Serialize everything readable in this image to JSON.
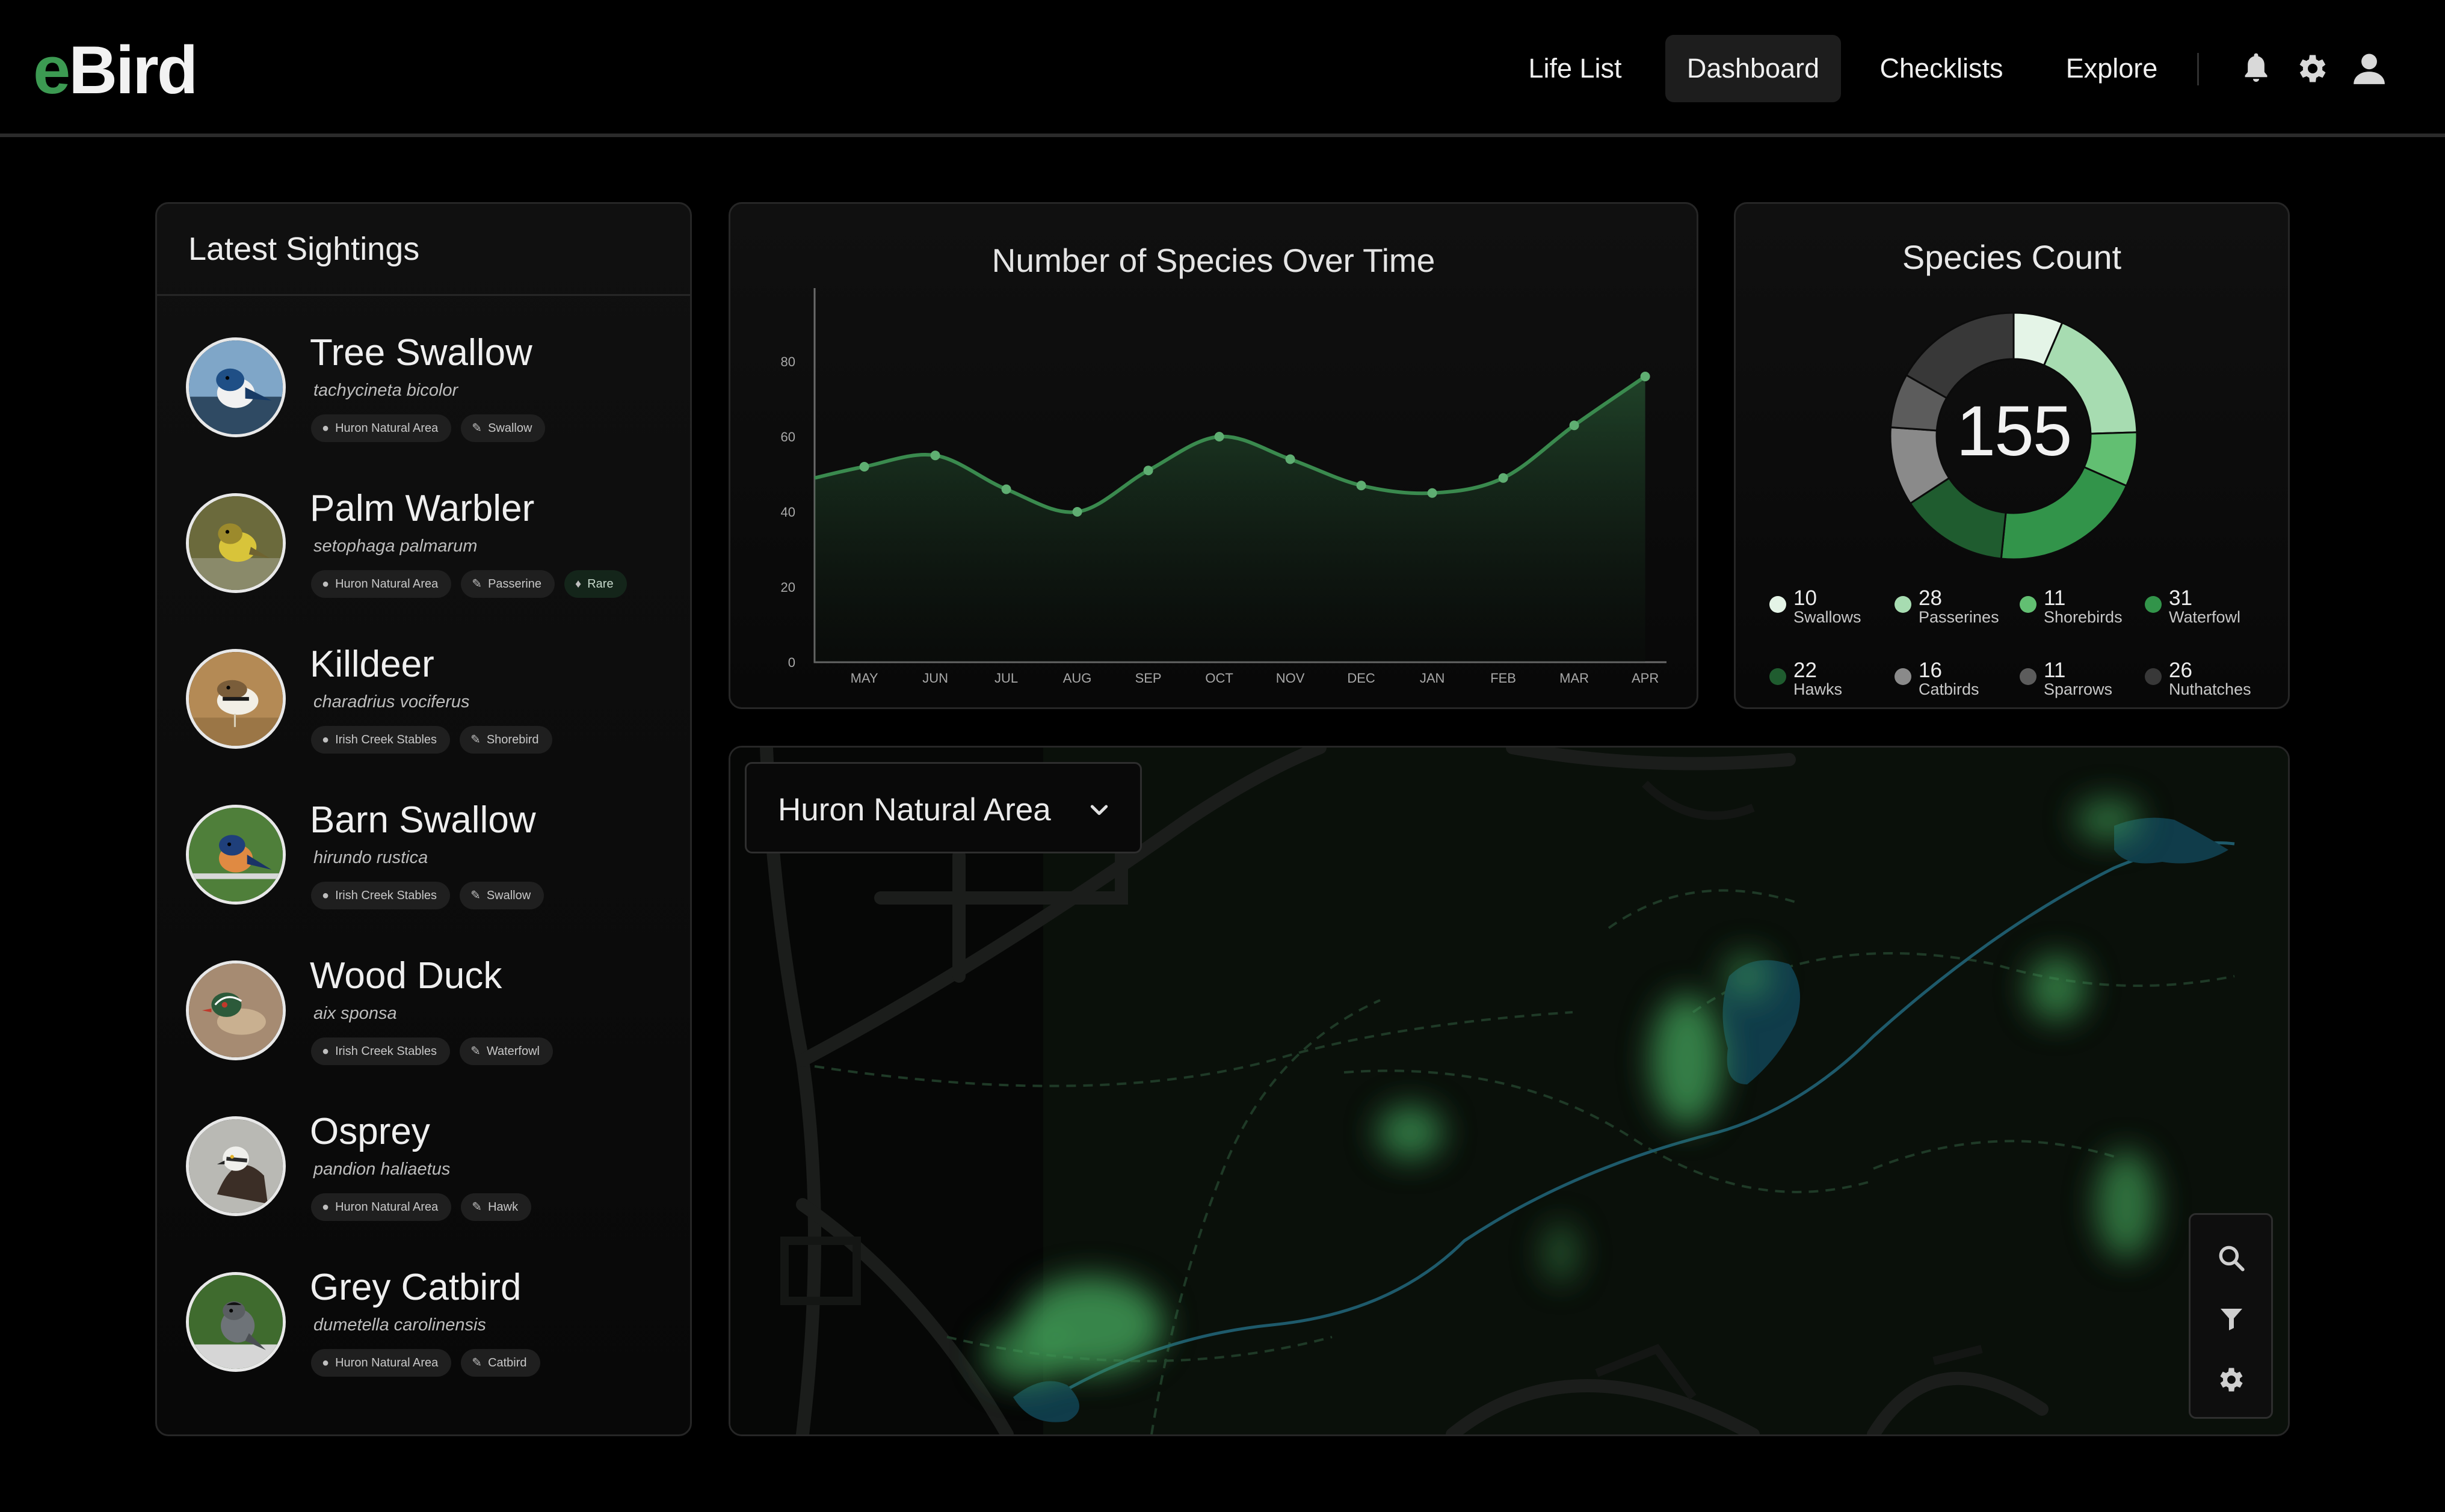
{
  "app": {
    "logo_e": "e",
    "logo_rest": "Bird"
  },
  "nav": {
    "items": [
      {
        "label": "Life List"
      },
      {
        "label": "Dashboard",
        "active": true
      },
      {
        "label": "Checklists"
      },
      {
        "label": "Explore"
      }
    ],
    "icons": [
      "bell-icon",
      "gear-icon",
      "user-icon"
    ]
  },
  "sightings": {
    "title": "Latest Sightings",
    "items": [
      {
        "name": "Tree Swallow",
        "scientific": "tachycineta bicolor",
        "location": "Huron Natural Area",
        "group": "Swallow",
        "rare": ""
      },
      {
        "name": "Palm Warbler",
        "scientific": "setophaga palmarum",
        "location": "Huron Natural Area",
        "group": "Passerine",
        "rare": "Rare"
      },
      {
        "name": "Killdeer",
        "scientific": "charadrius vociferus",
        "location": "Irish Creek Stables",
        "group": "Shorebird",
        "rare": ""
      },
      {
        "name": "Barn Swallow",
        "scientific": "hirundo rustica",
        "location": "Irish Creek Stables",
        "group": "Swallow",
        "rare": ""
      },
      {
        "name": "Wood Duck",
        "scientific": "aix sponsa",
        "location": "Irish Creek Stables",
        "group": "Waterfowl",
        "rare": ""
      },
      {
        "name": "Osprey",
        "scientific": "pandion haliaetus",
        "location": "Huron Natural Area",
        "group": "Hawk",
        "rare": ""
      },
      {
        "name": "Grey Catbird",
        "scientific": "dumetella carolinensis",
        "location": "Huron Natural Area",
        "group": "Catbird",
        "rare": ""
      }
    ]
  },
  "chart_data": {
    "type": "area",
    "title": "Number of Species Over Time",
    "xlabel": "",
    "ylabel": "",
    "categories": [
      "MAY",
      "JUN",
      "JUL",
      "AUG",
      "SEP",
      "OCT",
      "NOV",
      "DEC",
      "JAN",
      "FEB",
      "MAR",
      "APR"
    ],
    "x": [
      0.7,
      1.7,
      2.7,
      3.7,
      4.7,
      5.7,
      6.7,
      7.7,
      8.7,
      9.7,
      10.7,
      11.7
    ],
    "values": [
      52,
      55,
      46,
      40,
      51,
      60,
      54,
      47,
      45,
      49,
      63,
      76
    ],
    "start_value": 49,
    "yticks": [
      0,
      20,
      40,
      60,
      80
    ],
    "ylim": [
      0,
      100
    ],
    "grid": false,
    "color": "#3a8a4e"
  },
  "species_count": {
    "title": "Species Count",
    "total": "155",
    "segments": [
      {
        "label": "Swallows",
        "count": 10,
        "color": "#e4f4e7"
      },
      {
        "label": "Passerines",
        "count": 28,
        "color": "#a7dcb1"
      },
      {
        "label": "Shorebirds",
        "count": 11,
        "color": "#62bf72"
      },
      {
        "label": "Waterfowl",
        "count": 31,
        "color": "#32944a"
      },
      {
        "label": "Hawks",
        "count": 22,
        "color": "#1f5c2f"
      },
      {
        "label": "Catbirds",
        "count": 16,
        "color": "#8a8a8a"
      },
      {
        "label": "Sparrows",
        "count": 11,
        "color": "#5c5c5c"
      },
      {
        "label": "Nuthatches",
        "count": 26,
        "color": "#383838"
      }
    ]
  },
  "map": {
    "area_label": "Huron Natural Area",
    "tools": [
      "search-icon",
      "filter-icon",
      "gear-icon"
    ]
  },
  "colors": {
    "accent": "#3c9a52",
    "background": "#000000",
    "card": "#0d0d0d"
  }
}
